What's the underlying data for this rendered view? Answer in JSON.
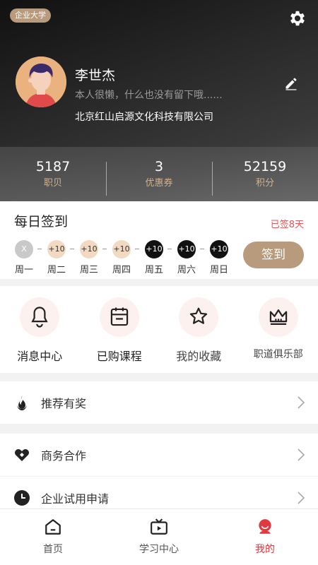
{
  "header": {
    "badge": "企业大学",
    "name": "李世杰",
    "motto": "本人很懒，什么也没有留下哦......",
    "company": "北京红山启源文化科技有限公司",
    "icons": {
      "settings": "gear-icon",
      "edit": "pencil-icon"
    }
  },
  "stats": [
    {
      "value": "5187",
      "label": "职贝"
    },
    {
      "value": "3",
      "label": "优惠券"
    },
    {
      "value": "52159",
      "label": "积分"
    }
  ],
  "checkin": {
    "title": "每日签到",
    "count": "已签8天",
    "button": "签到",
    "days": [
      {
        "mark": "X",
        "label": "周一",
        "state": "missed"
      },
      {
        "mark": "+10",
        "label": "周二",
        "state": "available"
      },
      {
        "mark": "+10",
        "label": "周三",
        "state": "available"
      },
      {
        "mark": "+10",
        "label": "周四",
        "state": "available"
      },
      {
        "mark": "+10",
        "label": "周五",
        "state": "future"
      },
      {
        "mark": "+10",
        "label": "周六",
        "state": "future"
      },
      {
        "mark": "+10",
        "label": "周日",
        "state": "future"
      }
    ]
  },
  "quick": [
    {
      "label": "消息中心",
      "icon": "bell-icon"
    },
    {
      "label": "已购课程",
      "icon": "calendar-icon"
    },
    {
      "label": "我的收藏",
      "icon": "star-icon"
    },
    {
      "label": "职道俱乐部",
      "icon": "crown-icon"
    }
  ],
  "menu": [
    {
      "label": "推荐有奖",
      "icon": "flame-icon"
    },
    {
      "label": "商务合作",
      "icon": "handshake-icon"
    },
    {
      "label": "企业试用申请",
      "icon": "clock-icon"
    }
  ],
  "tabs": [
    {
      "label": "首页",
      "icon": "home-icon"
    },
    {
      "label": "学习中心",
      "icon": "tv-icon"
    },
    {
      "label": "我的",
      "icon": "profile-icon",
      "active": true
    }
  ],
  "colors": {
    "accent": "#b89a7c",
    "active": "#e0393f",
    "statLabel": "#d4b28c"
  }
}
